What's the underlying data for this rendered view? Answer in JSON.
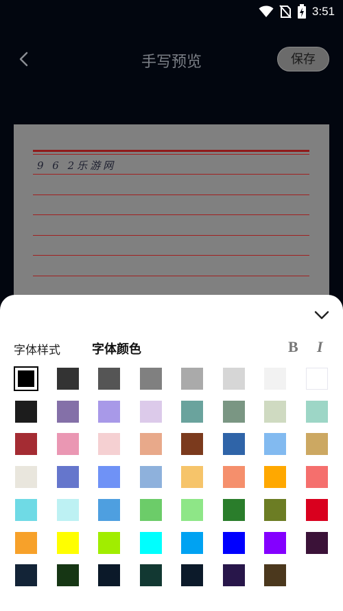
{
  "status_bar": {
    "time": "3:51"
  },
  "header": {
    "title": "手写预览",
    "save_label": "保存"
  },
  "preview": {
    "text": "9 6 2乐游网"
  },
  "panel": {
    "tab_style": "字体样式",
    "tab_color": "字体颜色",
    "bold_label": "B",
    "italic_label": "I",
    "selected_index": 0
  },
  "colors": [
    "#000000",
    "#333333",
    "#555555",
    "#808080",
    "#aaaaaa",
    "#d6d6d6",
    "#f2f2f2",
    "#ffffff",
    "#1c1c1c",
    "#8470a8",
    "#a899e8",
    "#dccaea",
    "#6aa39d",
    "#7a9683",
    "#cfdac1",
    "#9dd6c6",
    "#a42c33",
    "#ea97b3",
    "#f5d0d2",
    "#e8a98a",
    "#7b3a1d",
    "#2f64a8",
    "#82baf0",
    "#cca862",
    "#e9e6dd",
    "#6576cc",
    "#6f92f6",
    "#8eb1dc",
    "#f6c46a",
    "#f58f6c",
    "#ffa800",
    "#f56f6d",
    "#6fdae5",
    "#bdf1f3",
    "#4e9fe0",
    "#6ccc69",
    "#8ee687",
    "#2a7d2b",
    "#6c7d24",
    "#d9001e",
    "#f7a12a",
    "#fffe00",
    "#a1ed00",
    "#00fffe",
    "#00a2f2",
    "#0000ff",
    "#8400ff",
    "#3b1238",
    "#132437",
    "#163614",
    "#0b1929",
    "#123832",
    "#0c1a2a",
    "#28164a",
    "#4b381d"
  ]
}
